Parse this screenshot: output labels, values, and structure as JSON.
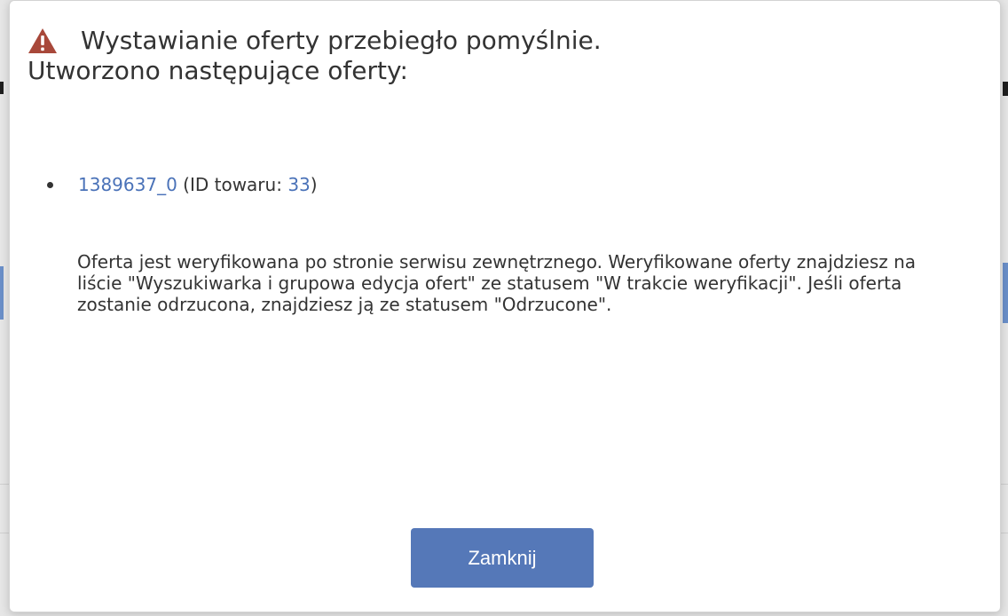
{
  "dialog": {
    "title_line1": "Wystawianie oferty przebiegło pomyślnie.",
    "title_line2": "Utworzono następujące oferty:",
    "icon": "warning-triangle-icon",
    "icon_color": "#a8483a",
    "offers": [
      {
        "offer_id": "1389637_0",
        "prefix": " (ID towaru: ",
        "product_id": "33",
        "suffix": ")"
      }
    ],
    "note": "Oferta jest weryfikowana po stronie serwisu zewnętrznego. Weryfikowane oferty znajdziesz na liście \"Wyszukiwarka i grupowa edycja ofert\" ze statusem \"W trakcie weryfikacji\". Jeśli oferta zostanie odrzucona, znajdziesz ją ze statusem \"Odrzucone\".",
    "close_label": "Zamknij",
    "button_color": "#5578b8",
    "link_color": "#4a72b8"
  }
}
